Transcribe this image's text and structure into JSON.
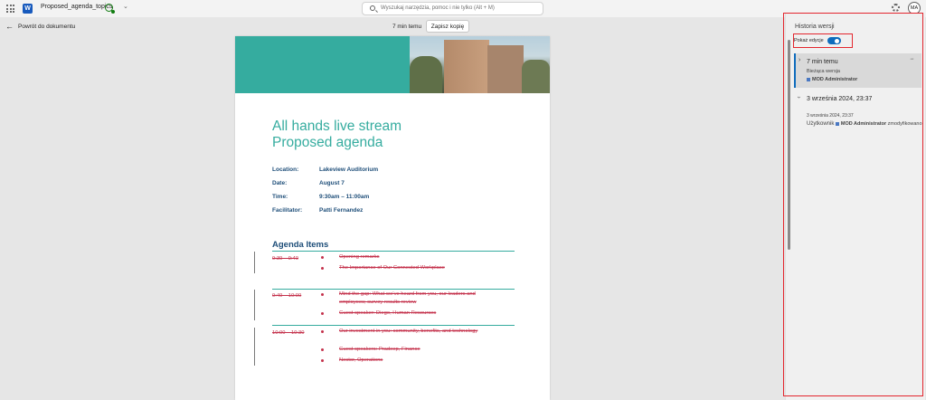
{
  "app": {
    "doc_title": "Proposed_agenda_topics",
    "search_placeholder": "Wyszukaj narzędzia, pomoc i nie tylko (Alt + M)",
    "avatar_initials": "MA",
    "back_label": "Powrót do dokumentu",
    "time_ago": "7 min temu",
    "save_copy_label": "Zapisz kopię"
  },
  "document": {
    "title_line1": "All hands live stream",
    "title_line2": "Proposed agenda",
    "details": [
      {
        "label": "Location:",
        "value": "Lakeview Auditorium"
      },
      {
        "label": "Date:",
        "value": "August 7"
      },
      {
        "label": "Time:",
        "value": "9:30am – 11:00am"
      },
      {
        "label": "Facilitator:",
        "value": "Patti Fernandez"
      }
    ],
    "agenda_heading": "Agenda Items",
    "agenda": [
      {
        "time": "9:30 – 9:40",
        "items": [
          "Opening remarks",
          "The Importance of Our Connected Workplace"
        ]
      },
      {
        "time": "9:40 – 10:00",
        "items": [
          "Mind the gap: What we’ve heard from you, our leaders and employees; survey results review",
          "Guest speaker: Diego, Human Resources"
        ]
      },
      {
        "time": "10:00 – 10:30",
        "items": [
          "Our investment in you: community, benefits, and technology",
          "Guest speakers: Pradeep, Finance",
          "Nestor, Operations"
        ]
      }
    ]
  },
  "history_panel": {
    "title": "Historia wersji",
    "toggle_label": "Pokaż edycje",
    "toggle_on": true,
    "versions": [
      {
        "time": "7 min temu",
        "note": "Bieżąca wersja",
        "author": "MOD Administrator"
      },
      {
        "time": "3 września 2024, 23:37",
        "note": "3 września 2024, 23:37",
        "user_prefix": "Użytkownik",
        "author": "MOD Administrator",
        "action": "zmodyfikowano"
      }
    ]
  },
  "colors": {
    "accent_teal": "#35ac9f",
    "heading_navy": "#1e4e79",
    "deletion_red": "#c4314b",
    "highlight_red": "#e3262e",
    "toggle_blue": "#0f6cbd"
  }
}
